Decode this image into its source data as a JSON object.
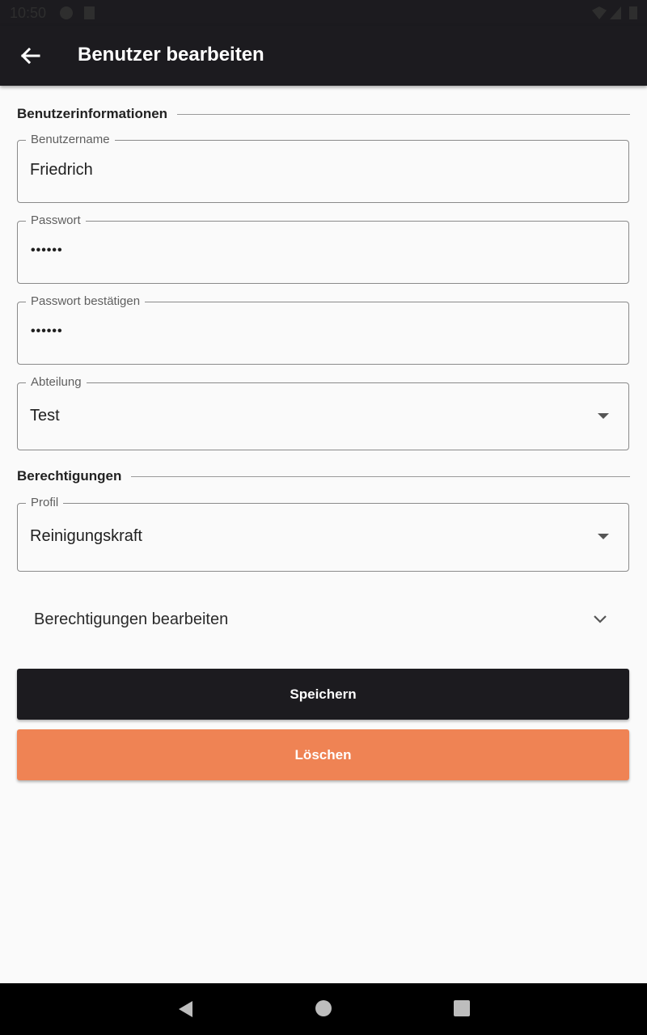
{
  "status_bar": {
    "time": "10:50"
  },
  "app_bar": {
    "title": "Benutzer bearbeiten",
    "back_icon": "arrow-back-icon"
  },
  "sections": {
    "user_info": "Benutzerinformationen",
    "permissions": "Berechtigungen"
  },
  "fields": {
    "username": {
      "label": "Benutzername",
      "value": "Friedrich"
    },
    "password": {
      "label": "Passwort",
      "value": "••••••"
    },
    "password_confirm": {
      "label": "Passwort bestätigen",
      "value": "••••••"
    },
    "department": {
      "label": "Abteilung",
      "value": "Test"
    },
    "profile": {
      "label": "Profil",
      "value": "Reinigungskraft"
    }
  },
  "expander": {
    "label": "Berechtigungen bearbeiten"
  },
  "buttons": {
    "save": "Speichern",
    "delete": "Löschen"
  },
  "colors": {
    "app_bar": "#1c1b1f",
    "save_button": "#1c1b1f",
    "delete_button": "#ef8354",
    "background": "#fafafa"
  }
}
